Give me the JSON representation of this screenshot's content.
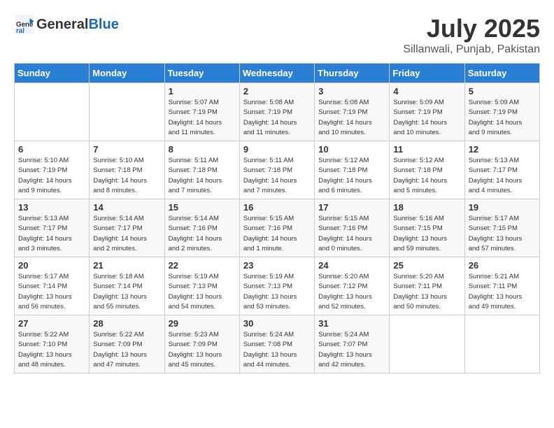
{
  "header": {
    "logo_line1": "General",
    "logo_line2": "Blue",
    "month": "July 2025",
    "location": "Sillanwali, Punjab, Pakistan"
  },
  "weekdays": [
    "Sunday",
    "Monday",
    "Tuesday",
    "Wednesday",
    "Thursday",
    "Friday",
    "Saturday"
  ],
  "weeks": [
    [
      {
        "day": "",
        "info": ""
      },
      {
        "day": "",
        "info": ""
      },
      {
        "day": "1",
        "info": "Sunrise: 5:07 AM\nSunset: 7:19 PM\nDaylight: 14 hours\nand 11 minutes."
      },
      {
        "day": "2",
        "info": "Sunrise: 5:08 AM\nSunset: 7:19 PM\nDaylight: 14 hours\nand 11 minutes."
      },
      {
        "day": "3",
        "info": "Sunrise: 5:08 AM\nSunset: 7:19 PM\nDaylight: 14 hours\nand 10 minutes."
      },
      {
        "day": "4",
        "info": "Sunrise: 5:09 AM\nSunset: 7:19 PM\nDaylight: 14 hours\nand 10 minutes."
      },
      {
        "day": "5",
        "info": "Sunrise: 5:09 AM\nSunset: 7:19 PM\nDaylight: 14 hours\nand 9 minutes."
      }
    ],
    [
      {
        "day": "6",
        "info": "Sunrise: 5:10 AM\nSunset: 7:19 PM\nDaylight: 14 hours\nand 9 minutes."
      },
      {
        "day": "7",
        "info": "Sunrise: 5:10 AM\nSunset: 7:18 PM\nDaylight: 14 hours\nand 8 minutes."
      },
      {
        "day": "8",
        "info": "Sunrise: 5:11 AM\nSunset: 7:18 PM\nDaylight: 14 hours\nand 7 minutes."
      },
      {
        "day": "9",
        "info": "Sunrise: 5:11 AM\nSunset: 7:18 PM\nDaylight: 14 hours\nand 7 minutes."
      },
      {
        "day": "10",
        "info": "Sunrise: 5:12 AM\nSunset: 7:18 PM\nDaylight: 14 hours\nand 6 minutes."
      },
      {
        "day": "11",
        "info": "Sunrise: 5:12 AM\nSunset: 7:18 PM\nDaylight: 14 hours\nand 5 minutes."
      },
      {
        "day": "12",
        "info": "Sunrise: 5:13 AM\nSunset: 7:17 PM\nDaylight: 14 hours\nand 4 minutes."
      }
    ],
    [
      {
        "day": "13",
        "info": "Sunrise: 5:13 AM\nSunset: 7:17 PM\nDaylight: 14 hours\nand 3 minutes."
      },
      {
        "day": "14",
        "info": "Sunrise: 5:14 AM\nSunset: 7:17 PM\nDaylight: 14 hours\nand 2 minutes."
      },
      {
        "day": "15",
        "info": "Sunrise: 5:14 AM\nSunset: 7:16 PM\nDaylight: 14 hours\nand 2 minutes."
      },
      {
        "day": "16",
        "info": "Sunrise: 5:15 AM\nSunset: 7:16 PM\nDaylight: 14 hours\nand 1 minute."
      },
      {
        "day": "17",
        "info": "Sunrise: 5:15 AM\nSunset: 7:16 PM\nDaylight: 14 hours\nand 0 minutes."
      },
      {
        "day": "18",
        "info": "Sunrise: 5:16 AM\nSunset: 7:15 PM\nDaylight: 13 hours\nand 59 minutes."
      },
      {
        "day": "19",
        "info": "Sunrise: 5:17 AM\nSunset: 7:15 PM\nDaylight: 13 hours\nand 57 minutes."
      }
    ],
    [
      {
        "day": "20",
        "info": "Sunrise: 5:17 AM\nSunset: 7:14 PM\nDaylight: 13 hours\nand 56 minutes."
      },
      {
        "day": "21",
        "info": "Sunrise: 5:18 AM\nSunset: 7:14 PM\nDaylight: 13 hours\nand 55 minutes."
      },
      {
        "day": "22",
        "info": "Sunrise: 5:19 AM\nSunset: 7:13 PM\nDaylight: 13 hours\nand 54 minutes."
      },
      {
        "day": "23",
        "info": "Sunrise: 5:19 AM\nSunset: 7:13 PM\nDaylight: 13 hours\nand 53 minutes."
      },
      {
        "day": "24",
        "info": "Sunrise: 5:20 AM\nSunset: 7:12 PM\nDaylight: 13 hours\nand 52 minutes."
      },
      {
        "day": "25",
        "info": "Sunrise: 5:20 AM\nSunset: 7:11 PM\nDaylight: 13 hours\nand 50 minutes."
      },
      {
        "day": "26",
        "info": "Sunrise: 5:21 AM\nSunset: 7:11 PM\nDaylight: 13 hours\nand 49 minutes."
      }
    ],
    [
      {
        "day": "27",
        "info": "Sunrise: 5:22 AM\nSunset: 7:10 PM\nDaylight: 13 hours\nand 48 minutes."
      },
      {
        "day": "28",
        "info": "Sunrise: 5:22 AM\nSunset: 7:09 PM\nDaylight: 13 hours\nand 47 minutes."
      },
      {
        "day": "29",
        "info": "Sunrise: 5:23 AM\nSunset: 7:09 PM\nDaylight: 13 hours\nand 45 minutes."
      },
      {
        "day": "30",
        "info": "Sunrise: 5:24 AM\nSunset: 7:08 PM\nDaylight: 13 hours\nand 44 minutes."
      },
      {
        "day": "31",
        "info": "Sunrise: 5:24 AM\nSunset: 7:07 PM\nDaylight: 13 hours\nand 42 minutes."
      },
      {
        "day": "",
        "info": ""
      },
      {
        "day": "",
        "info": ""
      }
    ]
  ]
}
